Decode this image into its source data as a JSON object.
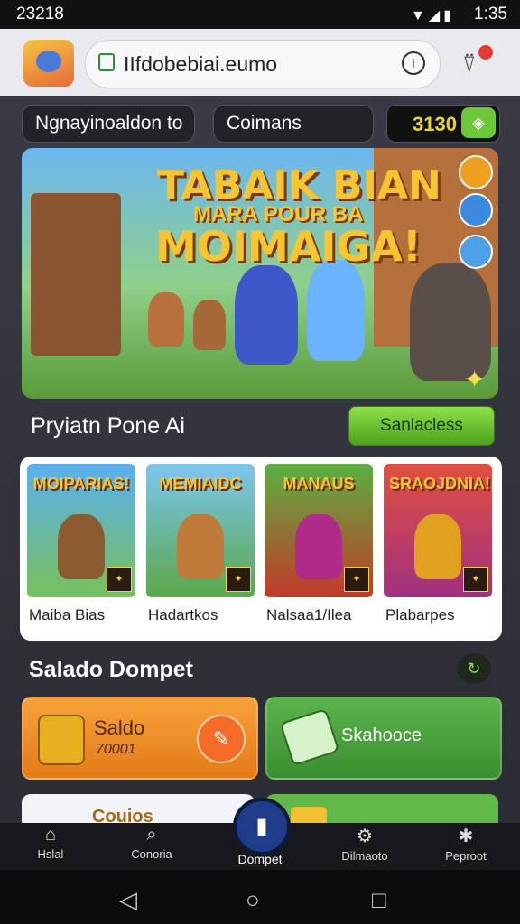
{
  "status_bar": {
    "time_left": "23218",
    "time_right": "1:35",
    "icons": "▼◢▮"
  },
  "browser": {
    "url": "IIfdobebiai.eumo",
    "info_icon": "info-icon",
    "notification_icon": "bell-icon"
  },
  "header": {
    "username": "Ngnayinoaldon to",
    "pill2": "Coimans",
    "coin_value": "3130",
    "coin_button_icon": "plus-icon"
  },
  "hero": {
    "title_line1": "TABAIK BIAN",
    "title_line2": "MARA POUR BA",
    "title_line3": "MOIMAIGA!"
  },
  "section1": {
    "title": "Pryiatn Pone Ai",
    "see_all": "Sanlacless"
  },
  "games": [
    {
      "title": "MOIPARIAS!",
      "label": "Maiba Bias"
    },
    {
      "title": "MEMIAIDC",
      "label": "Hadartkos"
    },
    {
      "title": "MANAUS",
      "label": "Nalsaa1/Ilea"
    },
    {
      "title": "SRAOJDNIA!",
      "label": "Plabarpes"
    }
  ],
  "section2": {
    "title": "Salado Dompet"
  },
  "wallet": {
    "saldo_title": "Saldo",
    "saldo_value": "70001",
    "swap_title": "Skahooce",
    "card3_title": "Couios"
  },
  "bottom_nav": {
    "items": [
      {
        "label": "Hslal",
        "icon": "home-icon"
      },
      {
        "label": "Conoria",
        "icon": "search-icon"
      },
      {
        "label": "Dompet",
        "icon": "wallet-icon"
      },
      {
        "label": "Dilmaoto",
        "icon": "tools-icon"
      },
      {
        "label": "Peproot",
        "icon": "gear-icon"
      }
    ]
  },
  "colors": {
    "accent_green": "#6cc83a",
    "accent_orange": "#f7a23a",
    "nav_active": "#1e3c8a"
  }
}
